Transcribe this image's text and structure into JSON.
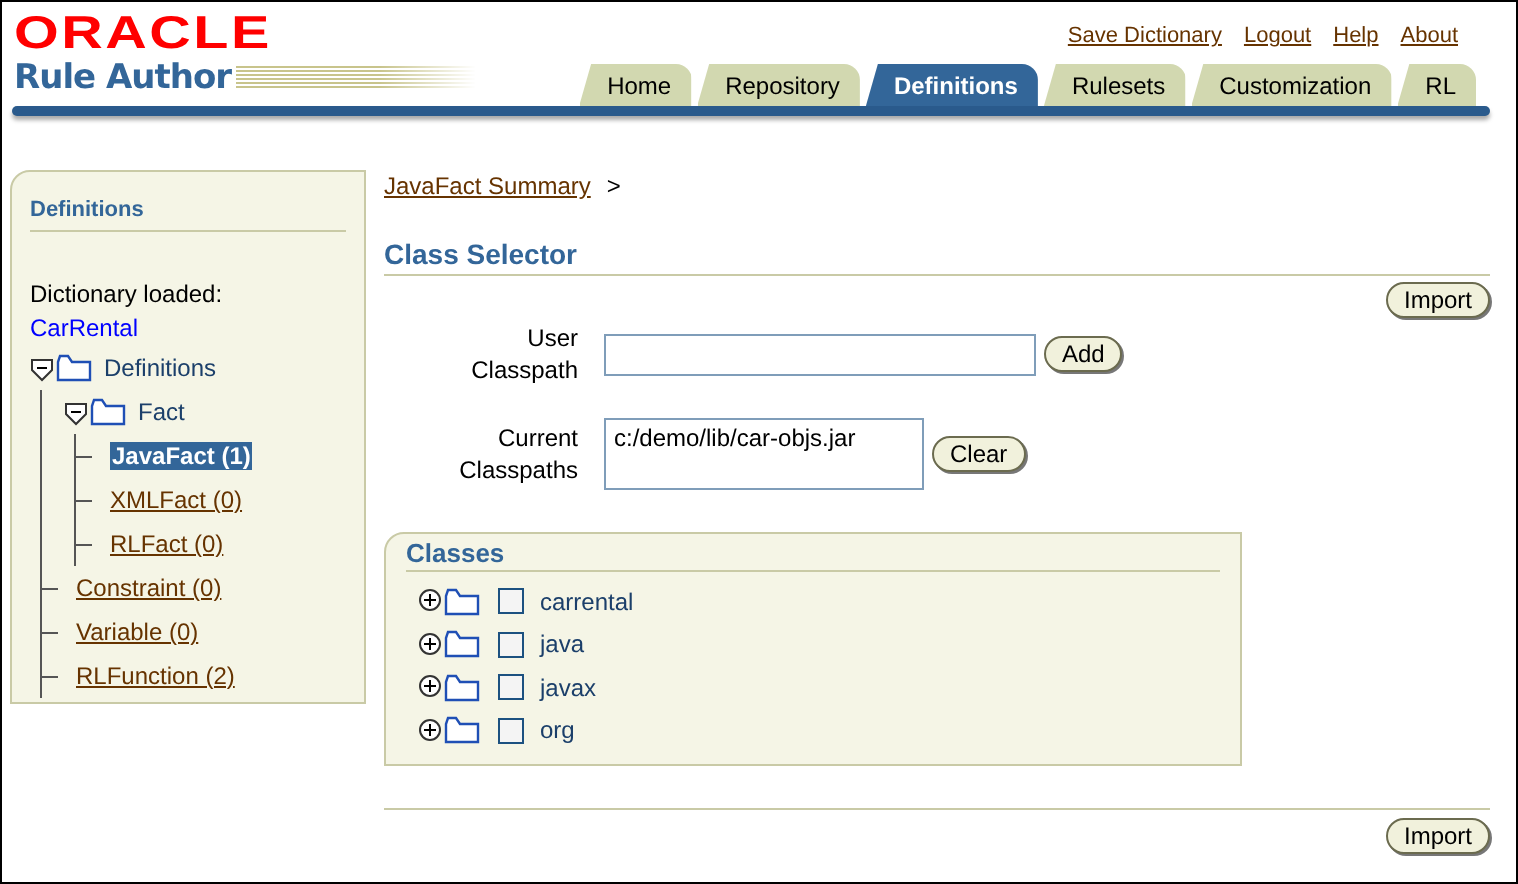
{
  "brand": {
    "logo": "ORACLE",
    "product": "Rule Author"
  },
  "global_links": [
    "Save Dictionary",
    "Logout",
    "Help",
    "About"
  ],
  "tabs": [
    {
      "label": "Home",
      "selected": false
    },
    {
      "label": "Repository",
      "selected": false
    },
    {
      "label": "Definitions",
      "selected": true
    },
    {
      "label": "Rulesets",
      "selected": false
    },
    {
      "label": "Customization",
      "selected": false
    },
    {
      "label": "RL",
      "selected": false
    }
  ],
  "sidebar": {
    "title": "Definitions",
    "loaded_label": "Dictionary loaded:",
    "dictionary": "CarRental",
    "tree": [
      {
        "kind": "folder",
        "label": "Definitions",
        "expanded": true,
        "children": [
          {
            "kind": "folder",
            "label": "Fact",
            "expanded": true,
            "children": [
              {
                "kind": "link",
                "label": "JavaFact (1)",
                "selected": true
              },
              {
                "kind": "link",
                "label": "XMLFact (0)",
                "selected": false
              },
              {
                "kind": "link",
                "label": "RLFact (0)",
                "selected": false
              }
            ]
          },
          {
            "kind": "link",
            "label": "Constraint (0)",
            "selected": false
          },
          {
            "kind": "link",
            "label": "Variable (0)",
            "selected": false
          },
          {
            "kind": "link",
            "label": "RLFunction (2)",
            "selected": false
          }
        ]
      }
    ]
  },
  "breadcrumb": {
    "link": "JavaFact Summary",
    "separator": ">"
  },
  "page_title": "Class Selector",
  "top_button": "Import",
  "user_classpath": {
    "label": "User Classpath",
    "button": "Add"
  },
  "current_classpaths": {
    "label": "Current Classpaths",
    "value": "c:/demo/lib/car-objs.jar",
    "button": "Clear"
  },
  "classes": {
    "title": "Classes",
    "items": [
      {
        "label": "carrental",
        "expanded": false,
        "checked": false
      },
      {
        "label": "java",
        "expanded": false,
        "checked": false
      },
      {
        "label": "javax",
        "expanded": false,
        "checked": false
      },
      {
        "label": "org",
        "expanded": false,
        "checked": false
      }
    ]
  },
  "bottom_button": "Import"
}
